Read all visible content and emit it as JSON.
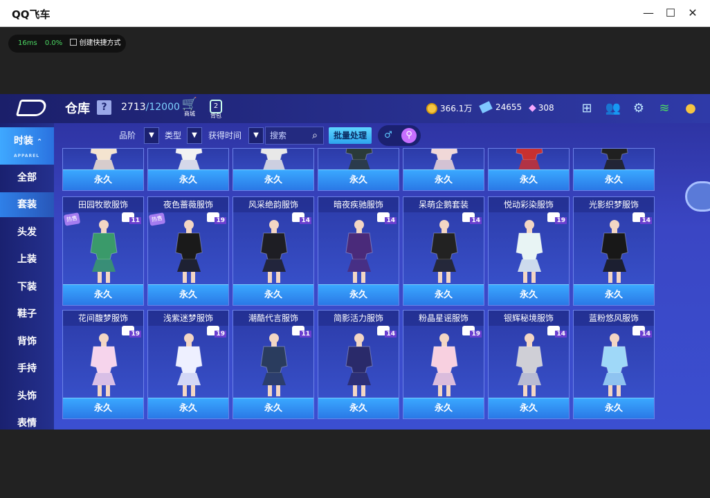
{
  "window": {
    "title": "QQ飞车",
    "controls": [
      "—",
      "☐",
      "✕"
    ]
  },
  "perf": {
    "ms": "16ms",
    "percent": "0.0%",
    "shortcut": "创建快捷方式"
  },
  "header": {
    "title": "仓库",
    "help": "?",
    "capacity_used": "2713",
    "capacity_max": "/12000",
    "shop_label": "商城",
    "bag_label": "背包",
    "bag_count": "2"
  },
  "currencies": {
    "coins": "366.1万",
    "tickets": "24655",
    "diamonds": "308"
  },
  "sidebar": {
    "header": {
      "label": "时装",
      "sub": "APPAREL"
    },
    "items": [
      {
        "label": "全部"
      },
      {
        "label": "套装"
      },
      {
        "label": "头发"
      },
      {
        "label": "上装"
      },
      {
        "label": "下装"
      },
      {
        "label": "鞋子"
      },
      {
        "label": "背饰"
      },
      {
        "label": "手持"
      },
      {
        "label": "头饰"
      },
      {
        "label": "表情"
      }
    ]
  },
  "filters": {
    "quality": "品阶",
    "type": "类型",
    "time": "获得时间",
    "search_placeholder": "搜索",
    "batch": "批量处理",
    "gender_male": "♂",
    "gender_search": "⚲"
  },
  "row_top": [
    {
      "duration": "永久",
      "color": "#f4e4d0"
    },
    {
      "duration": "永久",
      "color": "#f2f2f2"
    },
    {
      "duration": "永久",
      "color": "#e8e8e8"
    },
    {
      "duration": "永久",
      "color": "#2a3a3a"
    },
    {
      "duration": "永久",
      "color": "#f0d8d8"
    },
    {
      "duration": "永久",
      "color": "#c83030"
    },
    {
      "duration": "永久",
      "color": "#202020"
    }
  ],
  "row_mid": [
    {
      "name": "田园牧歌服饰",
      "level": "11",
      "hot": "热售",
      "duration": "永久",
      "color": "#3a9a6a"
    },
    {
      "name": "夜色蔷薇服饰",
      "level": "19",
      "hot": "热售",
      "duration": "永久",
      "color": "#1a1a1a"
    },
    {
      "name": "风采绝韵服饰",
      "level": "14",
      "duration": "永久",
      "color": "#1e1e24"
    },
    {
      "name": "暗夜疾驰服饰",
      "level": "14",
      "duration": "永久",
      "color": "#4a2a7a"
    },
    {
      "name": "呆萌企鹅套装",
      "level": "14",
      "duration": "永久",
      "color": "#222"
    },
    {
      "name": "悦动彩染服饰",
      "level": "19",
      "duration": "永久",
      "color": "#e8f4f4"
    },
    {
      "name": "光影织梦服饰",
      "level": "14",
      "duration": "永久",
      "color": "#181818"
    }
  ],
  "row_bottom": [
    {
      "name": "花间馥梦服饰",
      "level": "19",
      "duration": "永久",
      "color": "#f6d4ec"
    },
    {
      "name": "浅紫迷梦服饰",
      "level": "19",
      "duration": "永久",
      "color": "#eef0ff"
    },
    {
      "name": "潮酷代言服饰",
      "level": "11",
      "duration": "永久",
      "color": "#2a3c5e"
    },
    {
      "name": "简影活力服饰",
      "level": "14",
      "duration": "永久",
      "color": "#2a2a6a"
    },
    {
      "name": "粉晶星谣服饰",
      "level": "19",
      "duration": "永久",
      "color": "#f8d0e0"
    },
    {
      "name": "银辉秘境服饰",
      "level": "14",
      "duration": "永久",
      "color": "#cfcfd6"
    },
    {
      "name": "蓝粉悠风服饰",
      "level": "14",
      "duration": "永久",
      "color": "#9fd8f8"
    }
  ]
}
